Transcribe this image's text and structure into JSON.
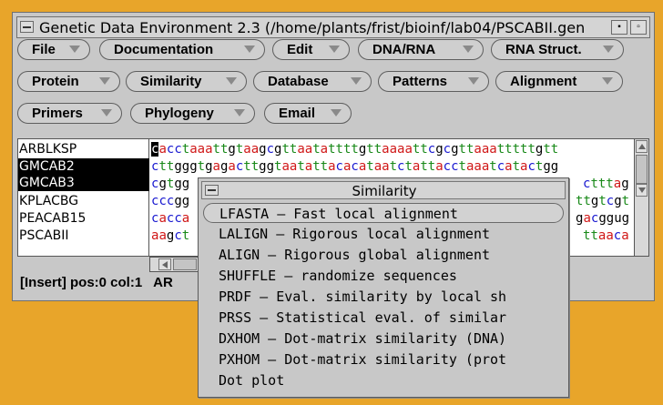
{
  "window": {
    "title": "Genetic Data Environment 2.3 (/home/plants/frist/bioinf/lab04/PSCABII.gen"
  },
  "menubar": {
    "row1": [
      "File",
      "Documentation",
      "Edit",
      "DNA/RNA",
      "RNA Struct."
    ],
    "row2": [
      "Protein",
      "Similarity",
      "Database",
      "Patterns",
      "Alignment"
    ],
    "row3": [
      "Primers",
      "Phylogeny",
      "Email"
    ]
  },
  "sequences": {
    "names": [
      "ARBLKSP",
      "GMCAB2",
      "GMCAB3",
      "KPLACBG",
      "PEACAB15",
      "PSCABII"
    ],
    "selected": [
      "GMCAB2",
      "GMCAB3"
    ],
    "lines": [
      "cacctaaattgtaagcgttaatattttgttaaaattcgcgttaaatttttgtt",
      "cttgggtgagacttggtaatattacacataatctattacctaaatcatactgg",
      "cgtgg",
      "cccgg",
      "cacca",
      "aagct"
    ],
    "lines_tail": [
      "",
      "",
      "ctttag",
      "ttgtcgt",
      "gacggug",
      "ttaaca"
    ],
    "colors": {
      "a": "#d01818",
      "c": "#1818d0",
      "g": "#000000",
      "t": "#1a8a1a"
    }
  },
  "status": {
    "text": "[Insert] pos:0 col:1",
    "extra": "AR"
  },
  "popup": {
    "title": "Similarity",
    "items": [
      "LFASTA – Fast local alignment",
      "LALIGN – Rigorous local alignment",
      "ALIGN – Rigorous global alignment",
      "SHUFFLE – randomize sequences",
      "PRDF – Eval. similarity by local sh",
      "PRSS – Statistical eval. of similar",
      "DXHOM – Dot-matrix similarity (DNA)",
      "PXHOM – Dot-matrix similarity (prot",
      "Dot plot"
    ],
    "highlighted": 0
  },
  "icons": {
    "window_menu": "window-menu-icon",
    "dropdown": "chevron-down-icon",
    "scroll_up": "arrow-up-icon",
    "scroll_down": "arrow-down-icon",
    "scroll_left": "arrow-left-icon"
  }
}
